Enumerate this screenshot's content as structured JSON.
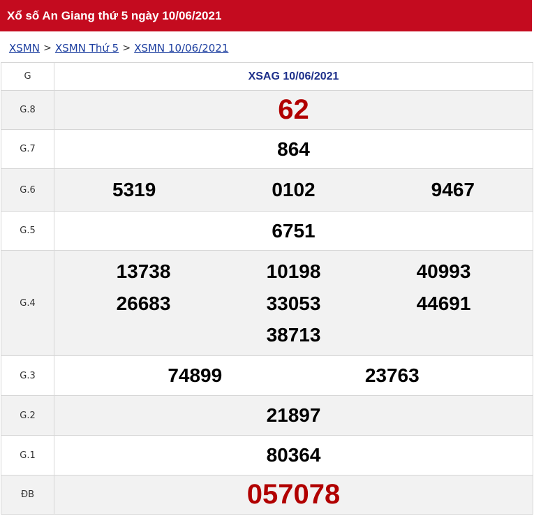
{
  "page": {
    "title": "Xổ số An Giang thứ 5 ngày 10/06/2021"
  },
  "breadcrumb": {
    "items": [
      "XSMN",
      "XSMN Thứ 5",
      "XSMN 10/06/2021"
    ],
    "separator": ">"
  },
  "table": {
    "col_label_header": "G",
    "station_header": "XSAG 10/06/2021",
    "prizes": {
      "g8": {
        "label": "G.8",
        "numbers": [
          "62"
        ]
      },
      "g7": {
        "label": "G.7",
        "numbers": [
          "864"
        ]
      },
      "g6": {
        "label": "G.6",
        "numbers": [
          "5319",
          "0102",
          "9467"
        ]
      },
      "g5": {
        "label": "G.5",
        "numbers": [
          "6751"
        ]
      },
      "g4": {
        "label": "G.4",
        "numbers": [
          "13738",
          "10198",
          "40993",
          "26683",
          "33053",
          "44691",
          "38713"
        ]
      },
      "g3": {
        "label": "G.3",
        "numbers": [
          "74899",
          "23763"
        ]
      },
      "g2": {
        "label": "G.2",
        "numbers": [
          "21897"
        ]
      },
      "g1": {
        "label": "G.1",
        "numbers": [
          "80364"
        ]
      },
      "db": {
        "label": "ĐB",
        "numbers": [
          "057078"
        ]
      }
    }
  },
  "colors": {
    "header_bg": "#c40b1f",
    "link": "#1d3fa0",
    "station_header": "#1d2f8a",
    "highlight_number": "#b10000",
    "alt_row_bg": "#f2f2f2"
  }
}
